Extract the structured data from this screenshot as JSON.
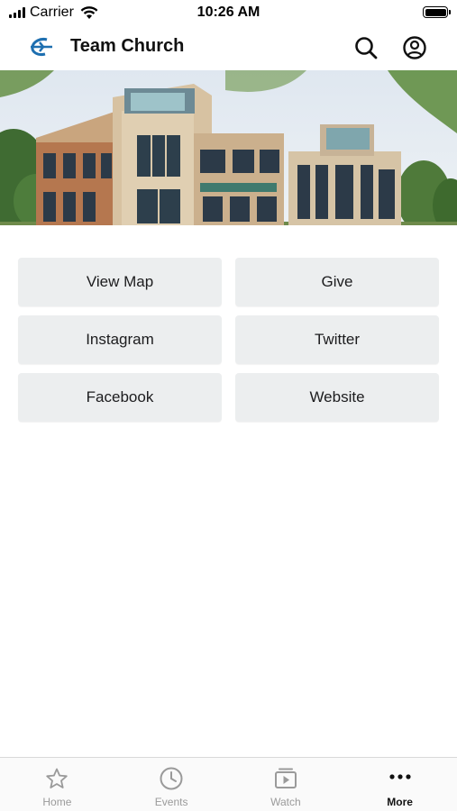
{
  "status_bar": {
    "carrier": "Carrier",
    "time": "10:26 AM"
  },
  "header": {
    "title": "Team Church",
    "logo_icon": "team-church-logo",
    "actions": [
      {
        "icon": "search-icon"
      },
      {
        "icon": "account-icon"
      }
    ]
  },
  "hero": {
    "image": "church building exterior photo"
  },
  "links": [
    {
      "label": "View Map"
    },
    {
      "label": "Give"
    },
    {
      "label": "Instagram"
    },
    {
      "label": "Twitter"
    },
    {
      "label": "Facebook"
    },
    {
      "label": "Website"
    }
  ],
  "tab_bar": {
    "tabs": [
      {
        "label": "Home",
        "icon": "star-icon",
        "active": false
      },
      {
        "label": "Events",
        "icon": "clock-icon",
        "active": false
      },
      {
        "label": "Watch",
        "icon": "play-icon",
        "active": false
      },
      {
        "label": "More",
        "icon": "more-icon",
        "active": true
      }
    ]
  },
  "colors": {
    "tab_inactive": "#9a9a9a",
    "tab_active": "#111111",
    "button_bg": "#eceeef",
    "logo_blue": "#1e6fb0"
  }
}
